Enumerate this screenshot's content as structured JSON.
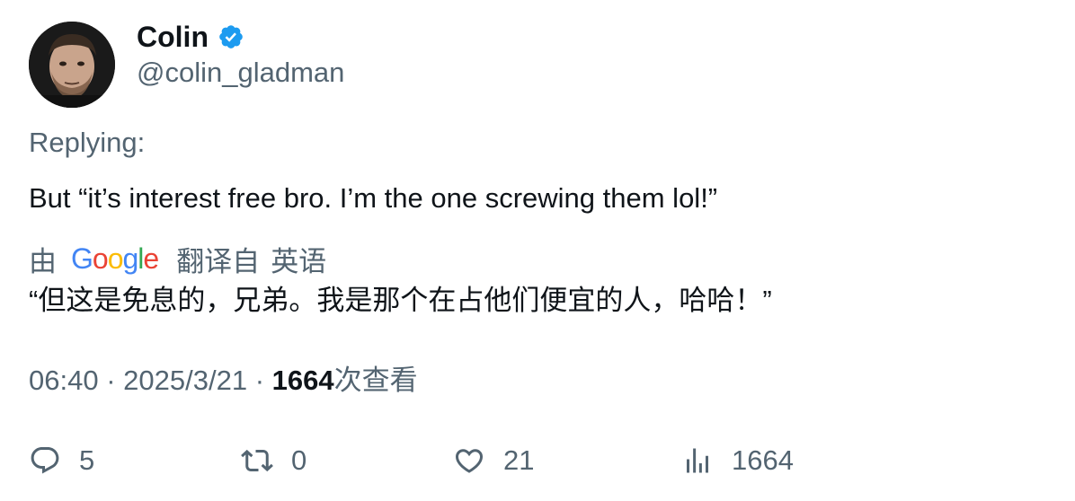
{
  "author": {
    "display_name": "Colin",
    "handle": "@colin_gladman",
    "verified_icon": "verified-badge-icon"
  },
  "replying_label": "Replying:",
  "tweet_text": "But “it’s interest free bro. I’m the one screwing them lol!”",
  "translation": {
    "by_label": "由",
    "provider_letters": [
      "G",
      "o",
      "o",
      "g",
      "l",
      "e"
    ],
    "provider_colors": [
      "#4285F4",
      "#EA4335",
      "#FBBC05",
      "#4285F4",
      "#34A853",
      "#EA4335"
    ],
    "from_label": "翻译自",
    "language": "英语",
    "translated_text": "“但这是免息的，兄弟。我是那个在占他们便宜的人，哈哈！”"
  },
  "meta": {
    "time": "06:40",
    "separator": "·",
    "date": "2025/3/21",
    "views_count": "1664",
    "views_label": "次查看"
  },
  "actions": {
    "reply_count": "5",
    "retweet_count": "0",
    "like_count": "21",
    "views_count": "1664"
  },
  "colors": {
    "text_primary": "#0f1419",
    "text_secondary": "#536471",
    "verified": "#1d9bf0"
  }
}
